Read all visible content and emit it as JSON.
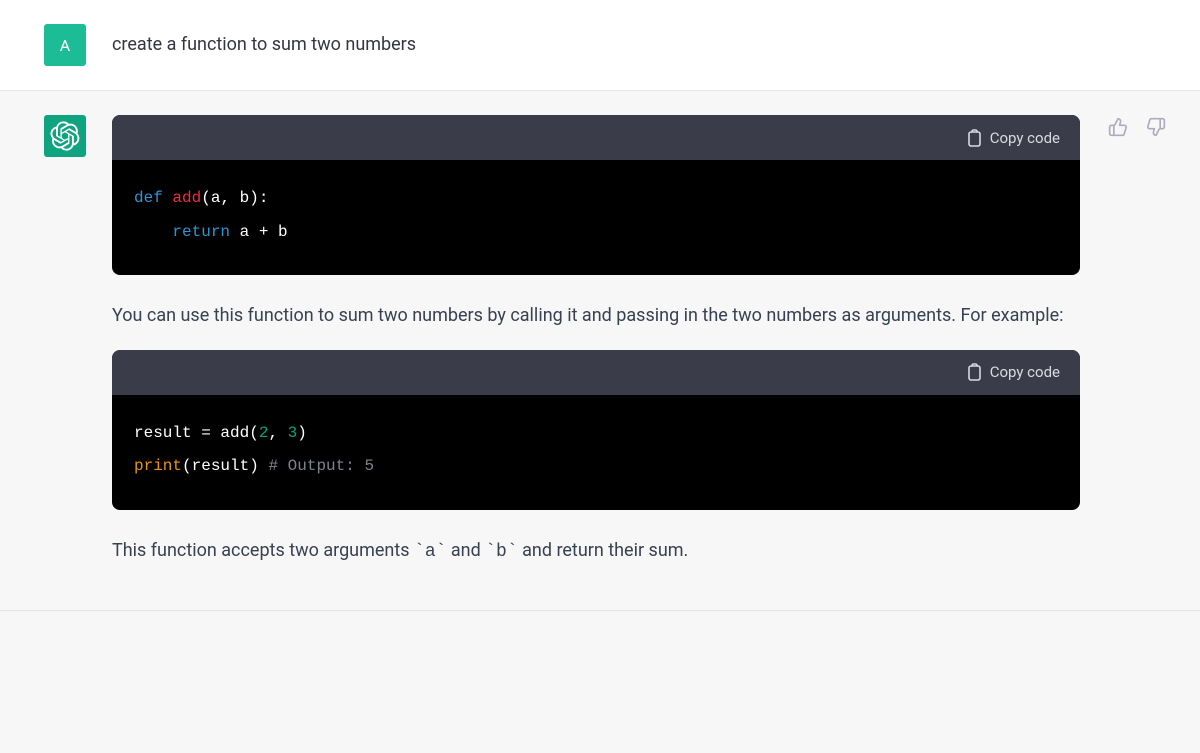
{
  "user": {
    "avatar_letter": "A",
    "message": "create a function to sum two numbers"
  },
  "assistant": {
    "copy_label": "Copy code",
    "paragraph1": "You can use this function to sum two numbers by calling it and passing in the two numbers as arguments. For example:",
    "paragraph2_pre": "This function accepts two arguments ",
    "paragraph2_code_a": "`a`",
    "paragraph2_mid": " and ",
    "paragraph2_code_b": "`b`",
    "paragraph2_post": " and return their sum.",
    "code1": {
      "def_kw": "def",
      "func_name": "add",
      "open_paren": "(",
      "params": "a, b",
      "close_paren_colon": "):",
      "indent": "    ",
      "return_kw": "return",
      "return_expr": " a + b"
    },
    "code2": {
      "line1_pre": "result = add(",
      "line1_arg1": "2",
      "line1_comma": ", ",
      "line1_arg2": "3",
      "line1_close": ")",
      "line2_call": "print",
      "line2_open": "(result) ",
      "line2_comment": "# Output: 5"
    }
  },
  "colors": {
    "accent": "#10a37f"
  }
}
